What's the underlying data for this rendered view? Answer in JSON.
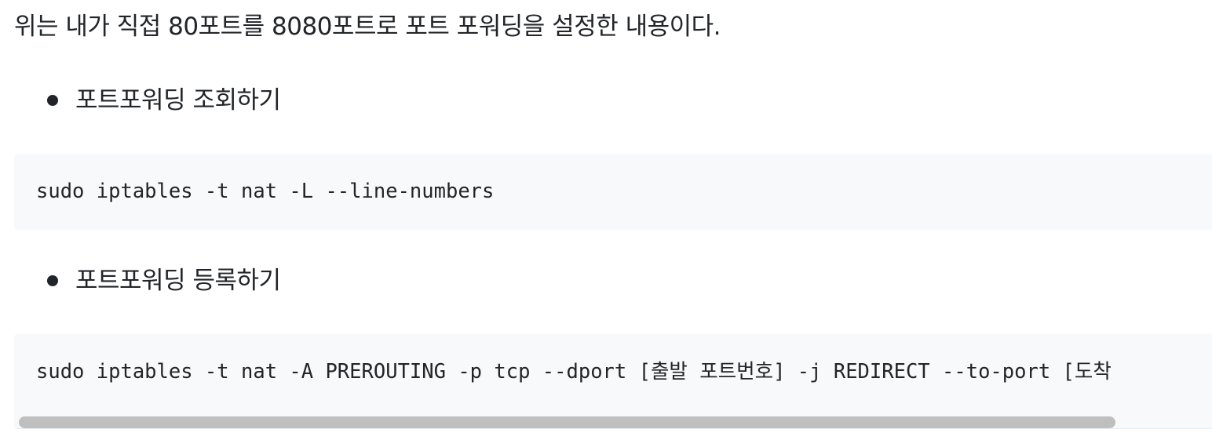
{
  "intro_text": "위는 내가 직접 80포트를 8080포트로 포트 포워딩을 설정한 내용이다.",
  "sections": [
    {
      "bullet": "포트포워딩 조회하기",
      "code": "sudo iptables -t nat -L --line-numbers"
    },
    {
      "bullet": "포트포워딩 등록하기",
      "code": "sudo iptables -t nat -A PREROUTING -p tcp --dport [출발 포트번호] -j REDIRECT --to-port [도착"
    }
  ]
}
